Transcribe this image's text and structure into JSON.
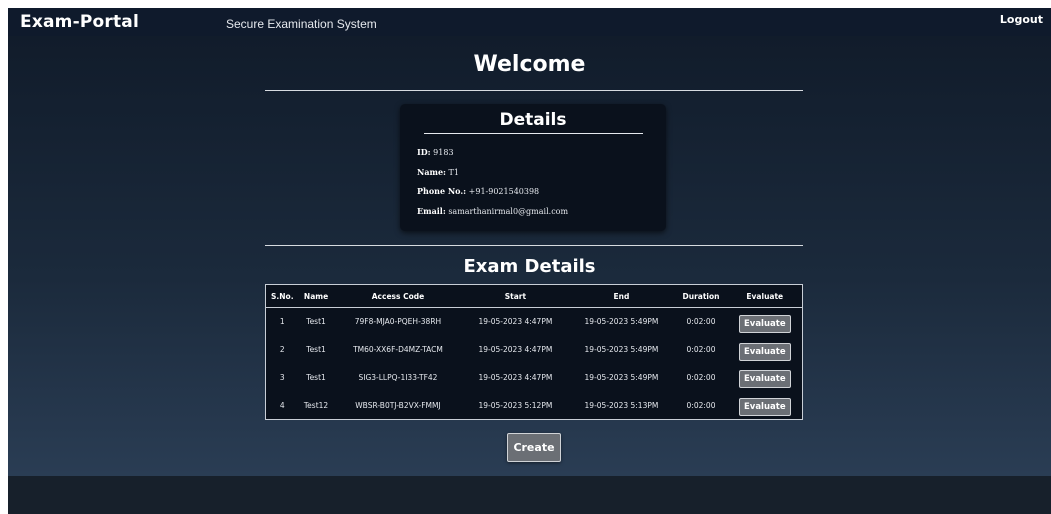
{
  "navbar": {
    "brand": "Exam-Portal",
    "subtitle": "Secure Examination System",
    "logout_label": "Logout"
  },
  "welcome": "Welcome",
  "details": {
    "title": "Details",
    "id_label": "ID:",
    "id_value": " 9183",
    "name_label": "Name:",
    "name_value": " T1",
    "phone_label": "Phone No.:",
    "phone_value": " +91-9021540398",
    "email_label": "Email:",
    "email_value": " samarthanirmal0@gmail.com"
  },
  "exam_details": {
    "title": "Exam Details",
    "columns": [
      "S.No.",
      "Name",
      "Access Code",
      "Start",
      "End",
      "Duration",
      "Evaluate"
    ],
    "rows": [
      {
        "sno": "1",
        "name": "Test1",
        "code": "79F8-MJA0-PQEH-38RH",
        "start": "19-05-2023 4:47PM",
        "end": "19-05-2023 5:49PM",
        "duration": "0:02:00",
        "evaluate": "Evaluate"
      },
      {
        "sno": "2",
        "name": "Test1",
        "code": "TM60-XX6F-D4MZ-TACM",
        "start": "19-05-2023 4:47PM",
        "end": "19-05-2023 5:49PM",
        "duration": "0:02:00",
        "evaluate": "Evaluate"
      },
      {
        "sno": "3",
        "name": "Test1",
        "code": "SIG3-LLPQ-1I33-TF42",
        "start": "19-05-2023 4:47PM",
        "end": "19-05-2023 5:49PM",
        "duration": "0:02:00",
        "evaluate": "Evaluate"
      },
      {
        "sno": "4",
        "name": "Test12",
        "code": "WBSR-B0TJ-B2VX-FMMJ",
        "start": "19-05-2023 5:12PM",
        "end": "19-05-2023 5:13PM",
        "duration": "0:02:00",
        "evaluate": "Evaluate"
      }
    ]
  },
  "create_label": "Create"
}
